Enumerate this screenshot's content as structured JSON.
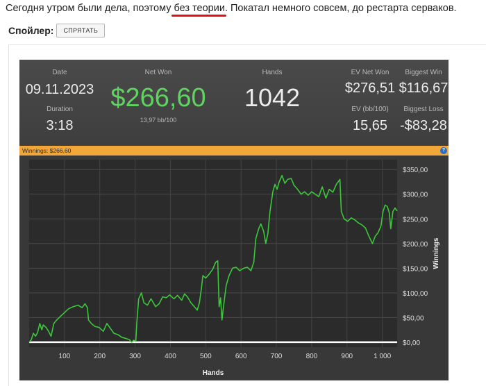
{
  "post": {
    "intro_before": "Сегодня утром были дела, поэтому ",
    "intro_highlight": "без теории",
    "intro_after": ". Покатал немного совсем, до рестарта серваков.",
    "spoiler_label": "Спойлер",
    "spoiler_colon": ":",
    "spoiler_button": "СПРЯТАТЬ"
  },
  "stats": {
    "date_label": "Date",
    "date_value": "09.11.2023",
    "duration_label": "Duration",
    "duration_value": "3:18",
    "net_won_label": "Net Won",
    "net_won_value": "$266,60",
    "bb_per_100": "13,97 bb/100",
    "hands_label": "Hands",
    "hands_value": "1042",
    "ev_net_won_label": "EV Net Won",
    "ev_net_won_value": "$276,51",
    "ev_bb_label": "EV (bb/100)",
    "ev_bb_value": "15,65",
    "biggest_win_label": "Biggest Win",
    "biggest_win_value": "$116,67",
    "biggest_loss_label": "Biggest Loss",
    "biggest_loss_value": "-$83,28"
  },
  "winbar": {
    "label": "Winnings: $266,60",
    "help": "?"
  },
  "colors": {
    "line": "#3bc93b",
    "net_won": "#5fd35f",
    "winbar": "#f2a73a",
    "zero_line": "#ffffff"
  },
  "chart_data": {
    "type": "line",
    "xlabel": "Hands",
    "ylabel": "Winnings",
    "xlim": [
      0,
      1042
    ],
    "ylim": [
      -10,
      370
    ],
    "x_ticks": [
      100,
      200,
      300,
      400,
      500,
      600,
      700,
      800,
      900,
      1000
    ],
    "x_tick_labels": [
      "100",
      "200",
      "300",
      "400",
      "500",
      "600",
      "700",
      "800",
      "900",
      "1 000"
    ],
    "y_ticks": [
      0,
      50,
      100,
      150,
      200,
      250,
      300,
      350
    ],
    "y_tick_labels": [
      "$0,00",
      "$50,00",
      "$100,00",
      "$150,00",
      "$200,00",
      "$250,00",
      "$300,00",
      "$350,00"
    ],
    "grid": true,
    "series": [
      {
        "points": [
          [
            0,
            0
          ],
          [
            6,
            5
          ],
          [
            12,
            18
          ],
          [
            18,
            12
          ],
          [
            24,
            20
          ],
          [
            30,
            38
          ],
          [
            36,
            25
          ],
          [
            40,
            35
          ],
          [
            48,
            30
          ],
          [
            55,
            22
          ],
          [
            62,
            12
          ],
          [
            70,
            38
          ],
          [
            78,
            45
          ],
          [
            88,
            52
          ],
          [
            100,
            60
          ],
          [
            112,
            68
          ],
          [
            125,
            72
          ],
          [
            138,
            75
          ],
          [
            150,
            70
          ],
          [
            158,
            78
          ],
          [
            165,
            70
          ],
          [
            168,
            45
          ],
          [
            176,
            38
          ],
          [
            186,
            32
          ],
          [
            198,
            30
          ],
          [
            210,
            22
          ],
          [
            220,
            38
          ],
          [
            230,
            28
          ],
          [
            240,
            18
          ],
          [
            252,
            15
          ],
          [
            262,
            10
          ],
          [
            272,
            8
          ],
          [
            284,
            5
          ],
          [
            290,
            0
          ],
          [
            296,
            4
          ],
          [
            302,
            2
          ],
          [
            305,
            40
          ],
          [
            310,
            88
          ],
          [
            318,
            100
          ],
          [
            325,
            80
          ],
          [
            335,
            75
          ],
          [
            345,
            88
          ],
          [
            358,
            72
          ],
          [
            368,
            78
          ],
          [
            378,
            92
          ],
          [
            388,
            90
          ],
          [
            398,
            96
          ],
          [
            410,
            88
          ],
          [
            420,
            95
          ],
          [
            432,
            85
          ],
          [
            440,
            98
          ],
          [
            448,
            92
          ],
          [
            458,
            80
          ],
          [
            468,
            72
          ],
          [
            476,
            65
          ],
          [
            482,
            80
          ],
          [
            488,
            110
          ],
          [
            492,
            135
          ],
          [
            500,
            130
          ],
          [
            510,
            138
          ],
          [
            520,
            148
          ],
          [
            528,
            162
          ],
          [
            534,
            165
          ],
          [
            538,
            72
          ],
          [
            542,
            90
          ],
          [
            546,
            45
          ],
          [
            552,
            82
          ],
          [
            558,
            115
          ],
          [
            566,
            135
          ],
          [
            576,
            150
          ],
          [
            586,
            152
          ],
          [
            596,
            145
          ],
          [
            608,
            150
          ],
          [
            618,
            152
          ],
          [
            628,
            145
          ],
          [
            636,
            162
          ],
          [
            642,
            210
          ],
          [
            650,
            230
          ],
          [
            656,
            240
          ],
          [
            664,
            225
          ],
          [
            670,
            200
          ],
          [
            676,
            220
          ],
          [
            682,
            265
          ],
          [
            690,
            305
          ],
          [
            696,
            320
          ],
          [
            702,
            310
          ],
          [
            708,
            325
          ],
          [
            716,
            338
          ],
          [
            724,
            322
          ],
          [
            732,
            330
          ],
          [
            742,
            332
          ],
          [
            750,
            318
          ],
          [
            760,
            310
          ],
          [
            770,
            300
          ],
          [
            780,
            305
          ],
          [
            790,
            298
          ],
          [
            800,
            305
          ],
          [
            810,
            300
          ],
          [
            820,
            295
          ],
          [
            830,
            315
          ],
          [
            840,
            292
          ],
          [
            850,
            310
          ],
          [
            860,
            304
          ],
          [
            870,
            320
          ],
          [
            880,
            330
          ],
          [
            884,
            265
          ],
          [
            892,
            250
          ],
          [
            902,
            245
          ],
          [
            912,
            252
          ],
          [
            922,
            248
          ],
          [
            932,
            242
          ],
          [
            942,
            238
          ],
          [
            952,
            232
          ],
          [
            962,
            215
          ],
          [
            972,
            200
          ],
          [
            980,
            215
          ],
          [
            988,
            222
          ],
          [
            996,
            235
          ],
          [
            1002,
            265
          ],
          [
            1008,
            278
          ],
          [
            1014,
            275
          ],
          [
            1020,
            262
          ],
          [
            1024,
            230
          ],
          [
            1030,
            265
          ],
          [
            1036,
            272
          ],
          [
            1042,
            266
          ]
        ]
      }
    ]
  }
}
